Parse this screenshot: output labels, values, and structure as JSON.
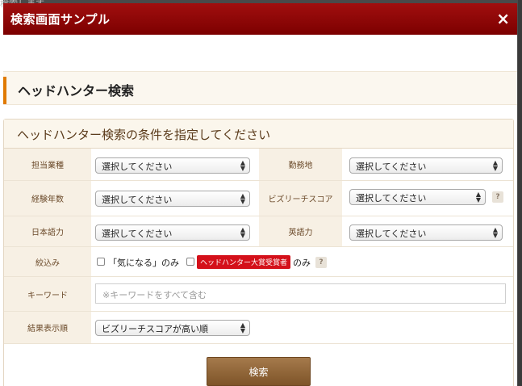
{
  "background": {
    "text": "検索します"
  },
  "modal": {
    "title": "検索画面サンプル",
    "close_icon": "close-icon"
  },
  "page": {
    "heading": "ヘッドハンター検索"
  },
  "panel": {
    "subheading": "ヘッドハンター検索の条件を指定してください"
  },
  "fields": {
    "duty_type": {
      "label": "担当業種",
      "value": "選択してください"
    },
    "location": {
      "label": "勤務地",
      "value": "選択してください"
    },
    "experience": {
      "label": "経験年数",
      "value": "選択してください"
    },
    "bizreach_score": {
      "label": "ビズリーチスコア",
      "value": "選択してください",
      "help": "?"
    },
    "japanese": {
      "label": "日本語力",
      "value": "選択してください"
    },
    "english": {
      "label": "英語力",
      "value": "選択してください"
    },
    "filter": {
      "label": "絞込み",
      "option1": "「気になる」のみ",
      "award_badge": "ヘッドハンター大賞受賞者",
      "option2_suffix": "のみ",
      "help": "?"
    },
    "keyword": {
      "label": "キーワード",
      "placeholder": "※キーワードをすべて含む"
    },
    "sort": {
      "label": "結果表示順",
      "value": "ビズリーチスコアが高い順"
    }
  },
  "search_button": {
    "label": "検索"
  },
  "colors": {
    "titlebar": "#8b0000",
    "accent": "#e07a00",
    "badge": "#d4101a",
    "button": "#8e6234"
  }
}
